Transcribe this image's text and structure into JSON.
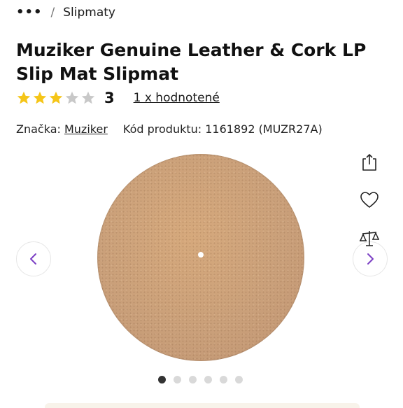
{
  "breadcrumb": {
    "more": "•••",
    "separator": "/",
    "current": "Slipmaty"
  },
  "product": {
    "title": "Muziker Genuine Leather & Cork LP Slip Mat Slipmat",
    "rating": {
      "stars_filled": 3,
      "stars_total": 5,
      "value": "3",
      "reviews_link": "1 x hodnotené"
    },
    "brand_label": "Značka:",
    "brand_name": "Muziker",
    "code_label": "Kód produktu:",
    "code_value": "1161892 (MUZR27A)"
  },
  "gallery": {
    "image_count": 6,
    "active_index": 0,
    "icons": {
      "prev": "chevron-left-icon",
      "next": "chevron-right-icon",
      "share": "share-icon",
      "wishlist": "heart-icon",
      "compare": "compare-scale-icon"
    }
  },
  "colors": {
    "star_filled": "#f5c518",
    "star_empty": "#c8c8c8",
    "accent_purple": "#7b3fc4",
    "text": "#111111",
    "cork": "#caa07a"
  }
}
